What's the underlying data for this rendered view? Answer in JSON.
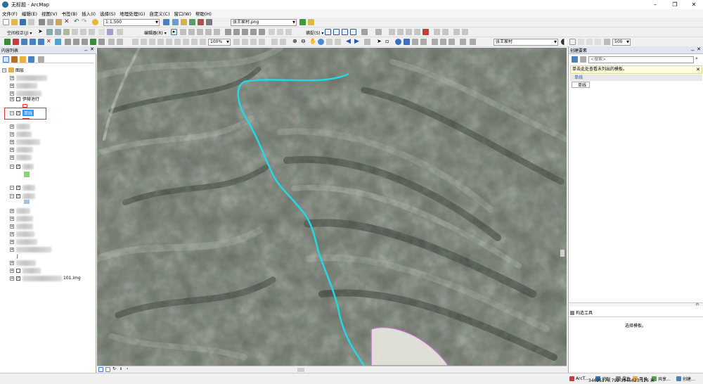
{
  "window": {
    "title": "无标题 - ArcMap",
    "minimize": "–",
    "maximize": "❐",
    "close": "✕"
  },
  "menu": [
    "文件(F)",
    "编辑(E)",
    "视图(V)",
    "书签(B)",
    "插入(I)",
    "选择(S)",
    "地理处理(G)",
    "自定义(C)",
    "窗口(W)",
    "帮助(H)"
  ],
  "toolbar": {
    "scale_value": "1:1,500",
    "layer_combo": "张王家村.png",
    "georef_label": "空间校正(J) ▾",
    "editor_label": "编辑器(R) ▾",
    "zoom_value": "100%",
    "snap_label": "捕捉(S) ▾",
    "target_layer": "张王家村",
    "opacity_value": "500"
  },
  "colors": {
    "highlight": "#3399ff",
    "line": "#21d9e6",
    "select_box": "#e03030"
  },
  "toc": {
    "title": "内容列表",
    "layers_group": "图层",
    "layer_yiyiyuan": "伊赫池行",
    "layer_danxian": "单线",
    "layer_img_suffix": "101.img",
    "layer_j": "J"
  },
  "create_features": {
    "title": "创建要素",
    "search_placeholder": "<搜索>",
    "info_text": "单击此处查看未列出的模板。",
    "template_group": "单线",
    "template_item": "单线",
    "construction_title": "构造工具",
    "construction_hint": "选择模板。"
  },
  "status": {
    "coords": "34625276.792  3946623.126 米",
    "tasks": [
      "ArcT...",
      "识别",
      "属性",
      "目录",
      "共享...",
      "创建..."
    ]
  }
}
